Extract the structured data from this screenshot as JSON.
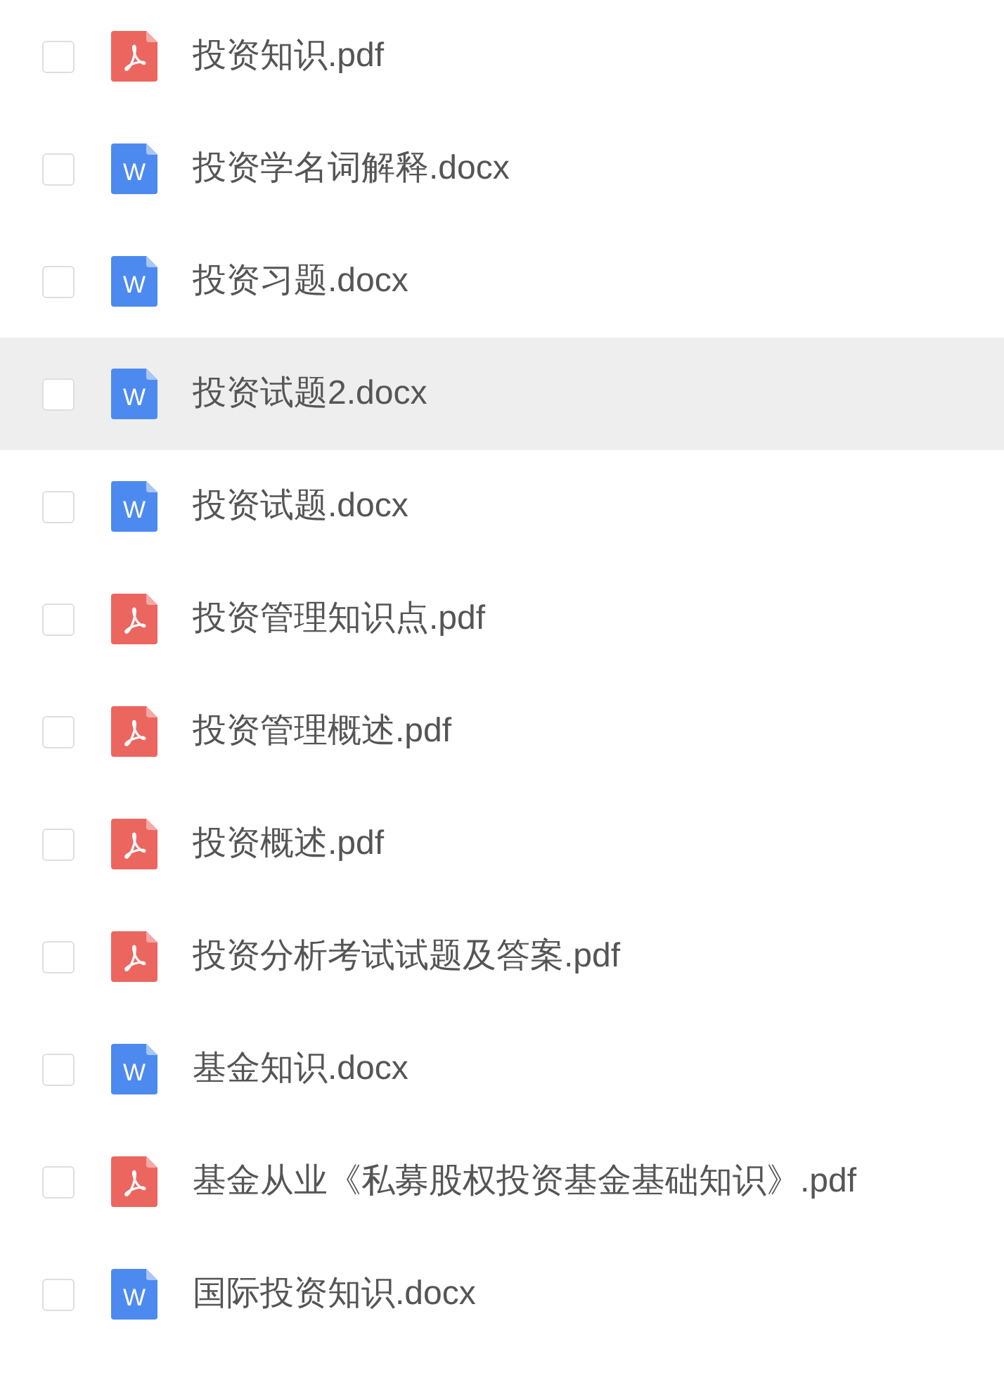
{
  "files": [
    {
      "name": "投资知识.pdf",
      "kind": "pdf",
      "checked": false,
      "highlighted": false
    },
    {
      "name": "投资学名词解释.docx",
      "kind": "docx",
      "icon_letter": "W",
      "checked": false,
      "highlighted": false
    },
    {
      "name": "投资习题.docx",
      "kind": "docx",
      "icon_letter": "W",
      "checked": false,
      "highlighted": false
    },
    {
      "name": "投资试题2.docx",
      "kind": "docx",
      "icon_letter": "W",
      "checked": false,
      "highlighted": true
    },
    {
      "name": "投资试题.docx",
      "kind": "docx",
      "icon_letter": "W",
      "checked": false,
      "highlighted": false
    },
    {
      "name": "投资管理知识点.pdf",
      "kind": "pdf",
      "checked": false,
      "highlighted": false
    },
    {
      "name": "投资管理概述.pdf",
      "kind": "pdf",
      "checked": false,
      "highlighted": false
    },
    {
      "name": "投资概述.pdf",
      "kind": "pdf",
      "checked": false,
      "highlighted": false
    },
    {
      "name": "投资分析考试试题及答案.pdf",
      "kind": "pdf",
      "checked": false,
      "highlighted": false
    },
    {
      "name": "基金知识.docx",
      "kind": "docx",
      "icon_letter": "W",
      "checked": false,
      "highlighted": false
    },
    {
      "name": "基金从业《私募股权投资基金基础知识》.pdf",
      "kind": "pdf",
      "checked": false,
      "highlighted": false
    },
    {
      "name": "国际投资知识.docx",
      "kind": "docx",
      "icon_letter": "W",
      "checked": false,
      "highlighted": false
    }
  ]
}
